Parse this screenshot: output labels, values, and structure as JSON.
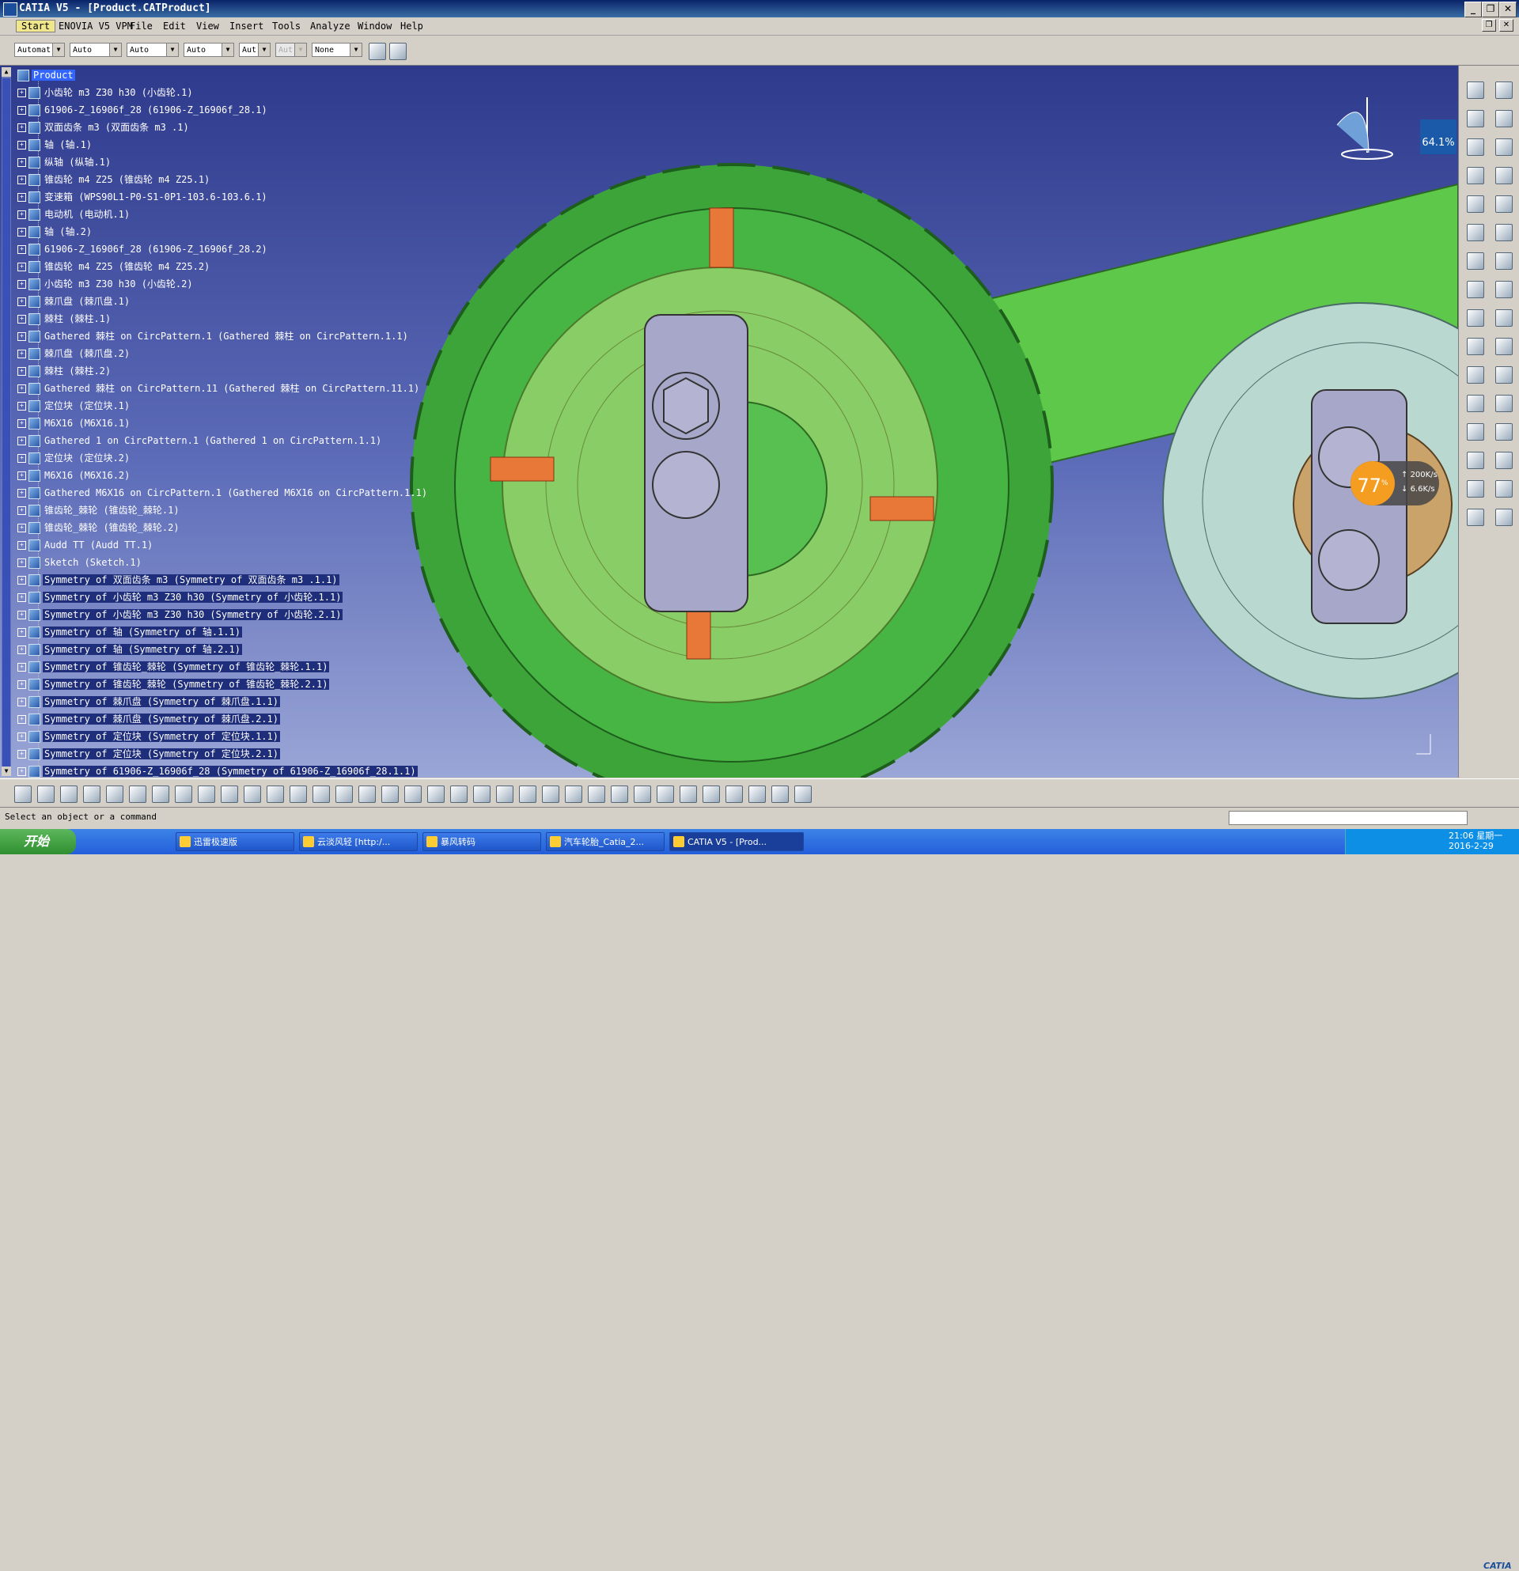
{
  "window": {
    "title": "CATIA V5 - [Product.CATProduct]",
    "minimize": "_",
    "restore": "❐",
    "close": "✕"
  },
  "menu": {
    "items": [
      "Start",
      "ENOVIA V5 VPM",
      "File",
      "Edit",
      "View",
      "Insert",
      "Tools",
      "Analyze",
      "Window",
      "Help"
    ]
  },
  "filters": {
    "combos": [
      "Automat",
      "Auto",
      "Auto",
      "Auto",
      "Aut",
      "Aut",
      "None"
    ]
  },
  "tree": {
    "root": "Product",
    "nodes": [
      "小齿轮 m3 Z30 h30 (小齿轮.1)",
      "61906-Z_16906f_28 (61906-Z_16906f_28.1)",
      "双面齿条 m3  (双面齿条 m3 .1)",
      "轴 (轴.1)",
      "纵轴 (纵轴.1)",
      "锥齿轮 m4 Z25 (锥齿轮 m4 Z25.1)",
      "变速箱 (WPS90L1-P0-S1-0P1-103.6-103.6.1)",
      "电动机 (电动机.1)",
      "轴 (轴.2)",
      "61906-Z_16906f_28 (61906-Z_16906f_28.2)",
      "锥齿轮 m4 Z25 (锥齿轮 m4 Z25.2)",
      "小齿轮 m3 Z30 h30 (小齿轮.2)",
      "棘爪盘 (棘爪盘.1)",
      "棘柱 (棘柱.1)",
      "Gathered 棘柱 on CircPattern.1 (Gathered 棘柱 on CircPattern.1.1)",
      "棘爪盘 (棘爪盘.2)",
      "棘柱 (棘柱.2)",
      "Gathered 棘柱 on CircPattern.11 (Gathered 棘柱 on CircPattern.11.1)",
      "定位块 (定位块.1)",
      "M6X16 (M6X16.1)",
      "Gathered 1 on CircPattern.1 (Gathered 1 on CircPattern.1.1)",
      "定位块 (定位块.2)",
      "M6X16 (M6X16.2)",
      "Gathered M6X16 on CircPattern.1 (Gathered M6X16 on CircPattern.1.1)",
      "锥齿轮_棘轮 (锥齿轮_棘轮.1)",
      "锥齿轮_棘轮 (锥齿轮_棘轮.2)",
      "Audd TT (Audd TT.1)",
      "Sketch (Sketch.1)",
      "Symmetry of 双面齿条 m3  (Symmetry of 双面齿条 m3 .1.1)",
      "Symmetry of 小齿轮 m3 Z30 h30 (Symmetry of 小齿轮.1.1)",
      "Symmetry of 小齿轮 m3 Z30 h30 (Symmetry of 小齿轮.2.1)",
      "Symmetry of 轴 (Symmetry of 轴.1.1)",
      "Symmetry of 轴 (Symmetry of 轴.2.1)",
      "Symmetry of 锥齿轮_棘轮 (Symmetry of 锥齿轮_棘轮.1.1)",
      "Symmetry of 锥齿轮_棘轮 (Symmetry of 锥齿轮_棘轮.2.1)",
      "Symmetry of 棘爪盘 (Symmetry of 棘爪盘.1.1)",
      "Symmetry of 棘爪盘 (Symmetry of 棘爪盘.2.1)",
      "Symmetry of 定位块 (Symmetry of 定位块.1.1)",
      "Symmetry of 定位块 (Symmetry of 定位块.2.1)",
      "Symmetry of 61906-Z_16906f_28 (Symmetry of 61906-Z_16906f_28.1.1)"
    ],
    "selected_from_index": 28
  },
  "overlay": {
    "zoom": "64.1%",
    "speed_percent": "77",
    "speed_unit": "%",
    "upload": "200K/s",
    "download": "6.6K/s"
  },
  "status": {
    "message": "Select an object or a command"
  },
  "taskbar": {
    "start": "开始",
    "tasks": [
      "迅雷极速版",
      "云淡风轻 [http:/...",
      "暴风转码",
      "汽车轮胎_Catia_2...",
      "CATIA V5 - [Prod..."
    ],
    "time": "21:06 星期一",
    "date": "2016-2-29"
  },
  "brand": {
    "logo_text": "CATIA"
  }
}
